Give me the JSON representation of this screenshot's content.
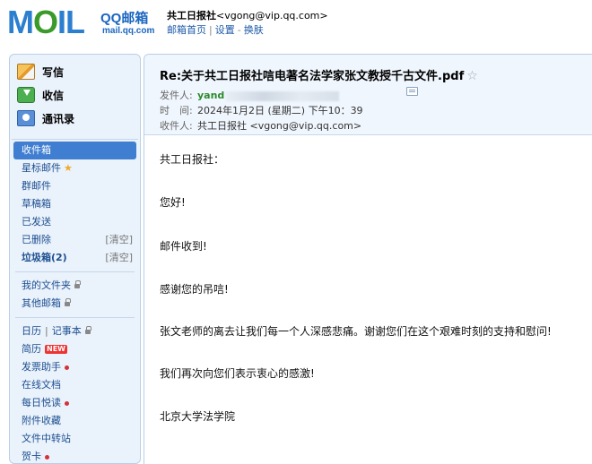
{
  "header": {
    "logo_text": "MOIL",
    "logo_brand": "QQ邮箱",
    "logo_domain": "mail.qq.com",
    "account_name": "共工日报社",
    "account_email": "<vgong@vip.qq.com>",
    "links": [
      "邮箱首页",
      "设置",
      "换肤"
    ]
  },
  "quick_actions": [
    {
      "label": "写信",
      "icon": "compose-icon"
    },
    {
      "label": "收信",
      "icon": "inbox-download-icon"
    },
    {
      "label": "通讯录",
      "icon": "contacts-icon"
    }
  ],
  "folders": {
    "inbox": "收件箱",
    "starred": "星标邮件",
    "group": "群邮件",
    "drafts": "草稿箱",
    "sent": "已发送",
    "deleted": "已删除",
    "deleted_clear": "[清空]",
    "spam": "垃圾箱(2)",
    "spam_clear": "[清空]",
    "my_folders": "我的文件夹",
    "other_mailboxes": "其他邮箱",
    "calendar": "日历",
    "notes": "记事本",
    "resume": "简历",
    "new_badge": "NEW",
    "invoice": "发票助手",
    "docs": "在线文档",
    "daily_read": "每日悦读",
    "attachments": "附件收藏",
    "file_transfer": "文件中转站",
    "cards": "贺卡"
  },
  "mail": {
    "subject": "Re:关于共工日报社唁电著名法学家张文教授千古文件.pdf",
    "from_label": "发件人:",
    "from_value": "yand",
    "time_label": "时　间:",
    "time_value": "2024年1月2日 (星期二) 下午10：39",
    "to_label": "收件人:",
    "to_value": "共工日报社 <vgong@vip.qq.com>",
    "body": [
      "共工日报社：",
      "您好!",
      "邮件收到!",
      "感谢您的吊唁!",
      "张文老师的离去让我们每一个人深感悲痛。谢谢您们在这个艰难时刻的支持和慰问!",
      "我们再次向您们表示衷心的感激!",
      "北京大学法学院"
    ]
  }
}
